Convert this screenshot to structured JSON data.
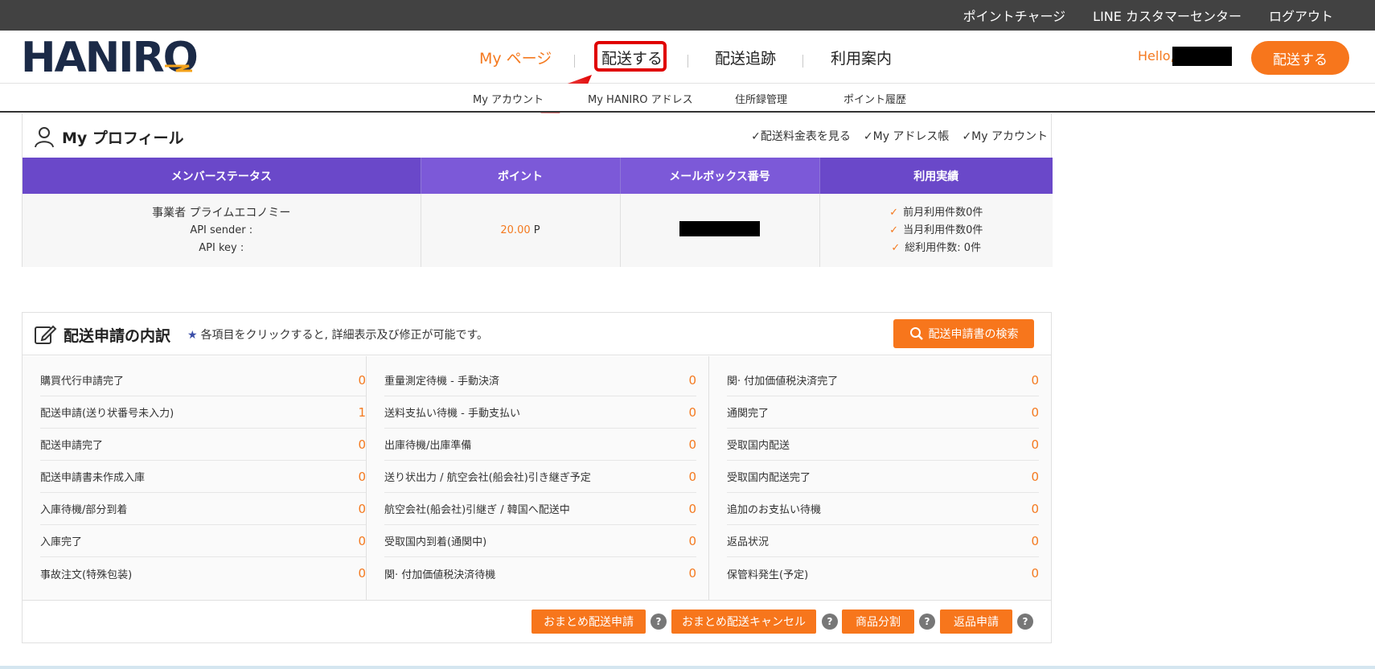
{
  "topbar": {
    "links": [
      "ポイントチャージ",
      "LINE カスタマーセンター",
      "ログアウト"
    ]
  },
  "header": {
    "logo": "HANIRO",
    "nav": [
      "My ページ",
      "配送する",
      "配送追跡",
      "利用案内"
    ],
    "hello": "Hello,",
    "cta": "配送する",
    "active_color": "#f47a20"
  },
  "subnav": [
    "My アカウント",
    "My HANIRO アドレス",
    "住所録管理",
    "ポイント履歴"
  ],
  "profile": {
    "title": "My プロフィール",
    "links": [
      "配送料金表を見る",
      "My アドレス帳",
      "My アカウント"
    ],
    "headers": [
      "メンバーステータス",
      "ポイント",
      "メールボックス番号",
      "利用実績"
    ],
    "status": {
      "grade": "事業者 プライムエコノミー",
      "api_sender": "API sender :",
      "api_key": "API key :"
    },
    "points": "20.00",
    "points_unit": "P",
    "usage": [
      "前月利用件数0件",
      "当月利用件数0件",
      "総利用件数: 0件"
    ]
  },
  "apps": {
    "title": "配送申請の内訳",
    "note": "各項目をクリックすると, 詳細表示及び修正が可能です。",
    "search": "配送申請書の検索",
    "columns": [
      [
        {
          "label": "購買代行申請完了",
          "value": "0"
        },
        {
          "label": "配送申請(送り状番号未入力)",
          "value": "1"
        },
        {
          "label": "配送申請完了",
          "value": "0"
        },
        {
          "label": "配送申請書未作成入庫",
          "value": "0"
        },
        {
          "label": "入庫待機/部分到着",
          "value": "0"
        },
        {
          "label": "入庫完了",
          "value": "0"
        },
        {
          "label": "事故注文(特殊包装)",
          "value": "0"
        }
      ],
      [
        {
          "label": "重量測定待機 - 手動決済",
          "value": "0"
        },
        {
          "label": "送料支払い待機 - 手動支払い",
          "value": "0"
        },
        {
          "label": "出庫待機/出庫準備",
          "value": "0"
        },
        {
          "label": "送り状出力 / 航空会社(船会社)引き継ぎ予定",
          "value": "0"
        },
        {
          "label": "航空会社(船会社)引継ぎ / 韓国へ配送中",
          "value": "0"
        },
        {
          "label": "受取国内到着(通関中)",
          "value": "0"
        },
        {
          "label": "関· 付加価値税決済待機",
          "value": "0"
        }
      ],
      [
        {
          "label": "関· 付加価値税決済完了",
          "value": "0"
        },
        {
          "label": "通関完了",
          "value": "0"
        },
        {
          "label": "受取国内配送",
          "value": "0"
        },
        {
          "label": "受取国内配送完了",
          "value": "0"
        },
        {
          "label": "追加のお支払い待機",
          "value": "0"
        },
        {
          "label": "返品状況",
          "value": "0"
        },
        {
          "label": "保管料発生(予定)",
          "value": "0"
        }
      ]
    ],
    "buttons": [
      "おまとめ配送申請",
      "おまとめ配送キャンセル",
      "商品分割",
      "返品申請"
    ],
    "help": "?"
  }
}
